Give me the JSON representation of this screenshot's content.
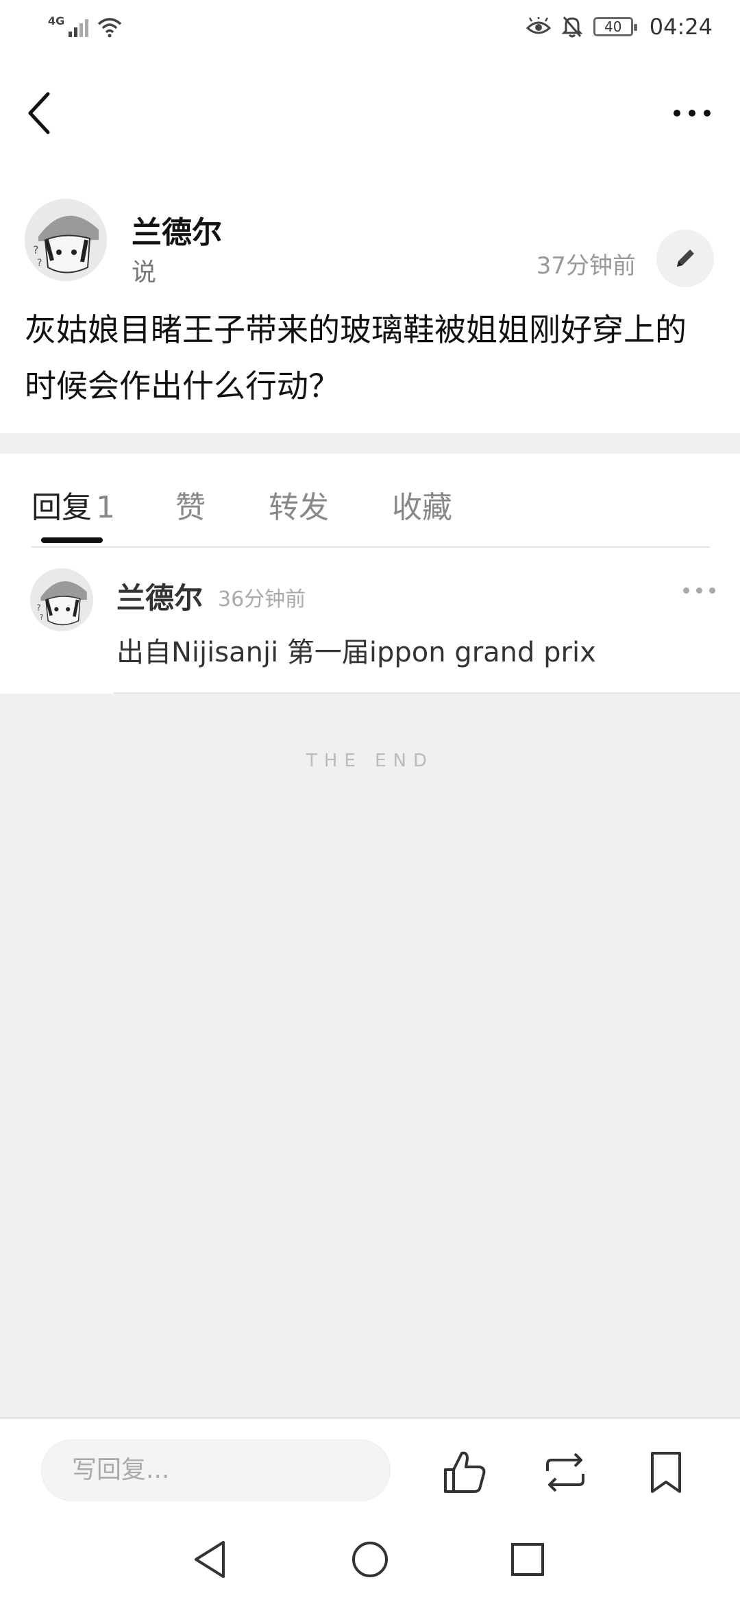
{
  "status_bar": {
    "network": "4G",
    "battery": "40",
    "time": "04:24"
  },
  "post": {
    "author": "兰德尔",
    "verb": "说",
    "time": "37分钟前",
    "content": "灰姑娘目睹王子带来的玻璃鞋被姐姐刚好穿上的时候会作出什么行动？"
  },
  "tabs": {
    "reply_label": "回复",
    "reply_count": "1",
    "like_label": "赞",
    "forward_label": "转发",
    "collect_label": "收藏"
  },
  "reply": {
    "author": "兰德尔",
    "time": "36分钟前",
    "content": "出自Nijisanji 第一届ippon grand prix"
  },
  "end_text": "THE END",
  "bottom": {
    "input_placeholder": "写回复..."
  }
}
